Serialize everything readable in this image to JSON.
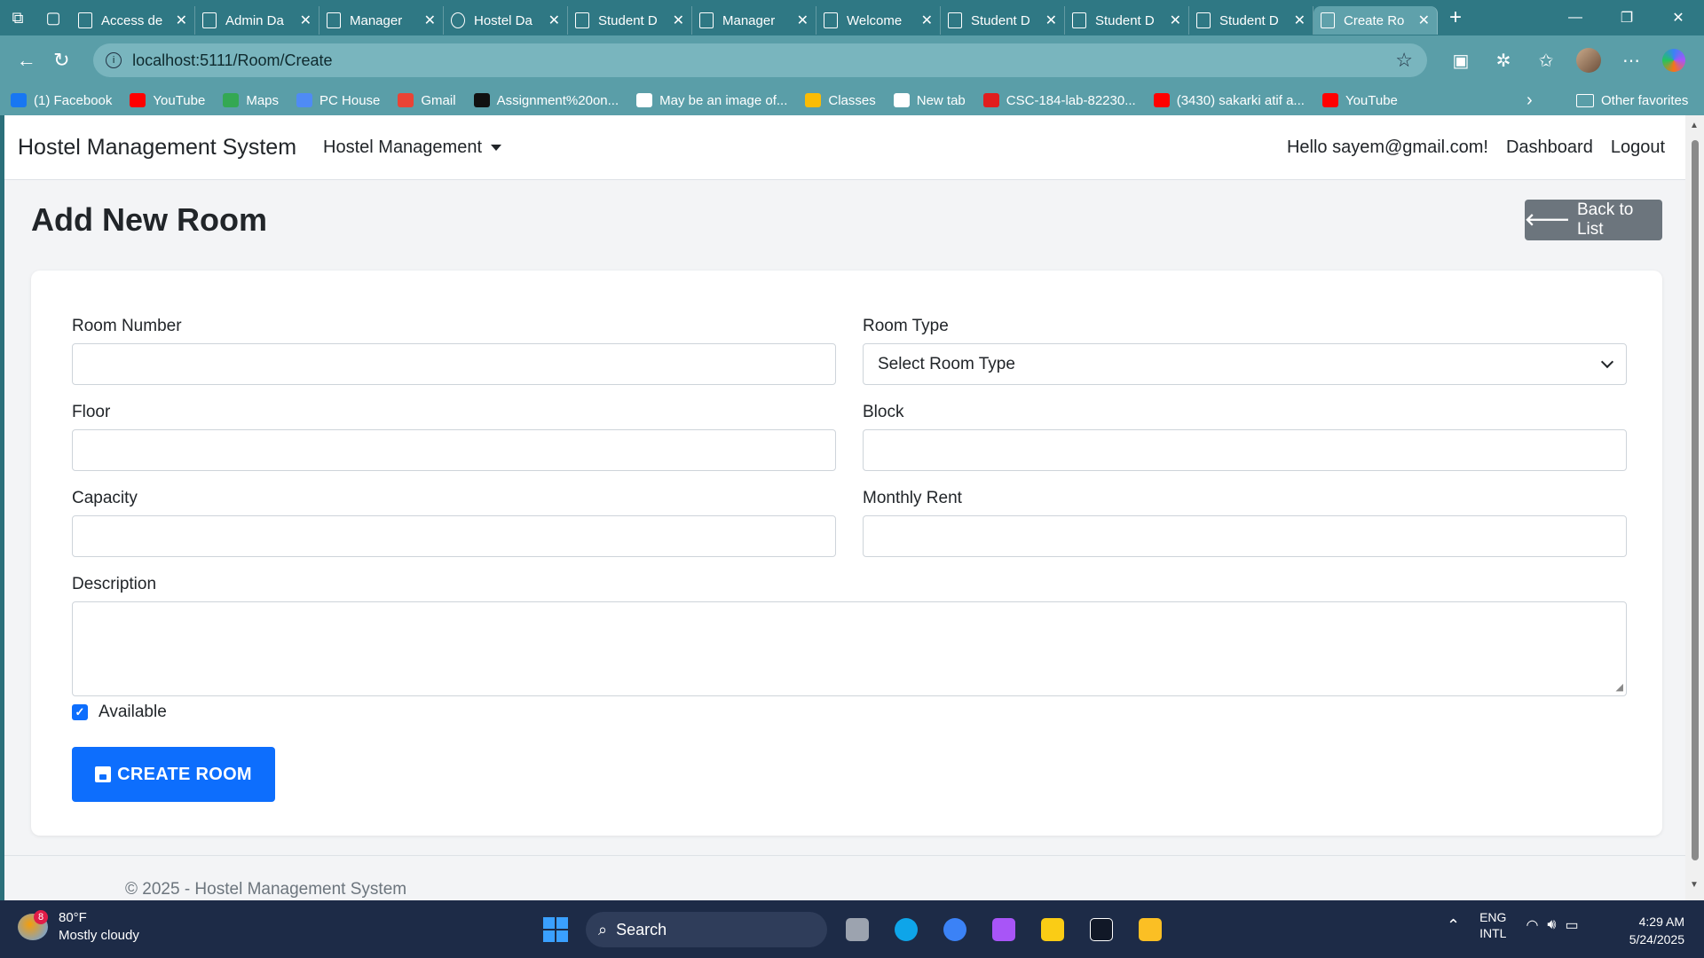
{
  "browser": {
    "tabs": [
      {
        "label": "Access de",
        "icon": "page"
      },
      {
        "label": "Admin Da",
        "icon": "page"
      },
      {
        "label": "Manager",
        "icon": "page"
      },
      {
        "label": "Hostel Da",
        "icon": "globe"
      },
      {
        "label": "Student D",
        "icon": "page"
      },
      {
        "label": "Manager",
        "icon": "page"
      },
      {
        "label": "Welcome",
        "icon": "page"
      },
      {
        "label": "Student D",
        "icon": "page"
      },
      {
        "label": "Student D",
        "icon": "page"
      },
      {
        "label": "Student D",
        "icon": "page"
      },
      {
        "label": "Create Ro",
        "icon": "page",
        "active": true
      }
    ],
    "new_tab": "+",
    "url": "localhost:5111/Room/Create",
    "bookmarks": [
      {
        "label": "(1) Facebook",
        "color": "#1877f2"
      },
      {
        "label": "YouTube",
        "color": "#ff0000"
      },
      {
        "label": "Maps",
        "color": "#34a853"
      },
      {
        "label": "PC House",
        "color": "#4f8bf5"
      },
      {
        "label": "Gmail",
        "color": "#ea4335"
      },
      {
        "label": "Assignment%20on...",
        "color": "#111111"
      },
      {
        "label": "May be an image of...",
        "color": "#ffffff"
      },
      {
        "label": "Classes",
        "color": "#fbbc04"
      },
      {
        "label": "New tab",
        "color": "#ffffff"
      },
      {
        "label": "CSC-184-lab-82230...",
        "color": "#e11d1d"
      },
      {
        "label": "(3430) sakarki atif a...",
        "color": "#ff0000"
      },
      {
        "label": "YouTube",
        "color": "#ff0000"
      }
    ],
    "other_favorites": "Other favorites"
  },
  "site": {
    "brand": "Hostel Management System",
    "menu_label": "Hostel Management",
    "greeting": "Hello sayem@gmail.com!",
    "dashboard": "Dashboard",
    "logout": "Logout"
  },
  "page": {
    "title": "Add New Room",
    "back_button": "Back to List"
  },
  "form": {
    "room_number_label": "Room Number",
    "room_number_value": "",
    "room_type_label": "Room Type",
    "room_type_selected": "Select Room Type",
    "floor_label": "Floor",
    "floor_value": "",
    "block_label": "Block",
    "block_value": "",
    "capacity_label": "Capacity",
    "capacity_value": "",
    "monthly_rent_label": "Monthly Rent",
    "monthly_rent_value": "",
    "description_label": "Description",
    "description_value": "",
    "available_label": "Available",
    "available_checked": true,
    "submit_label": "CREATE ROOM"
  },
  "footer": {
    "text": "© 2025 - Hostel Management System"
  },
  "taskbar": {
    "weather_badge": "8",
    "temperature": "80°F",
    "condition": "Mostly cloudy",
    "search_label": "Search",
    "lang_1": "ENG",
    "lang_2": "INTL",
    "time": "4:29 AM",
    "date": "5/24/2025"
  },
  "colors": {
    "primary": "#0d6efd",
    "secondary": "#6c757d",
    "browser_chrome": "#5a9ea8"
  }
}
